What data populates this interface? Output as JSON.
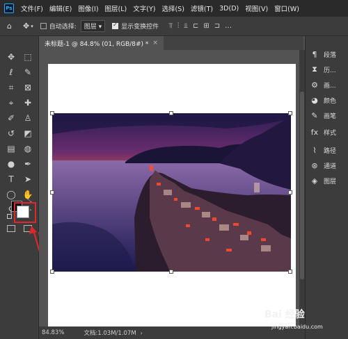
{
  "app": {
    "logo_text": "Ps"
  },
  "menu": [
    "文件(F)",
    "编辑(E)",
    "图像(I)",
    "图层(L)",
    "文字(Y)",
    "选择(S)",
    "滤镜(T)",
    "3D(D)",
    "视图(V)",
    "窗口(W)"
  ],
  "options": {
    "auto_select_label": "自动选择:",
    "layer_select_value": "图层",
    "show_transform_label": "显示变换控件"
  },
  "tab": {
    "title": "未标题-1 @ 84.8% (01, RGB/8#) *",
    "close": "×"
  },
  "panels": [
    {
      "icon": "paragraph-icon",
      "label": "段落"
    },
    {
      "icon": "history-icon",
      "label": "历..."
    },
    {
      "icon": "brush-settings-icon",
      "label": "画..."
    },
    {
      "icon": "color-icon",
      "label": "颜色"
    },
    {
      "icon": "brush-icon",
      "label": "画笔"
    },
    {
      "icon": "styles-icon",
      "label": "样式"
    },
    {
      "icon": "paths-icon",
      "label": "路径"
    },
    {
      "icon": "channels-icon",
      "label": "通道"
    },
    {
      "icon": "layers-icon",
      "label": "图层"
    }
  ],
  "status": {
    "zoom": "84.83%",
    "doc_info": "文档:1.03M/1.07M"
  },
  "watermark": {
    "text": "Bai 经验",
    "sub": "jingyan.baidu.com"
  },
  "colors": {
    "foreground": "#000000",
    "background": "#ffffff",
    "annotation": "#e0262a",
    "accent": "#31a8ff"
  }
}
